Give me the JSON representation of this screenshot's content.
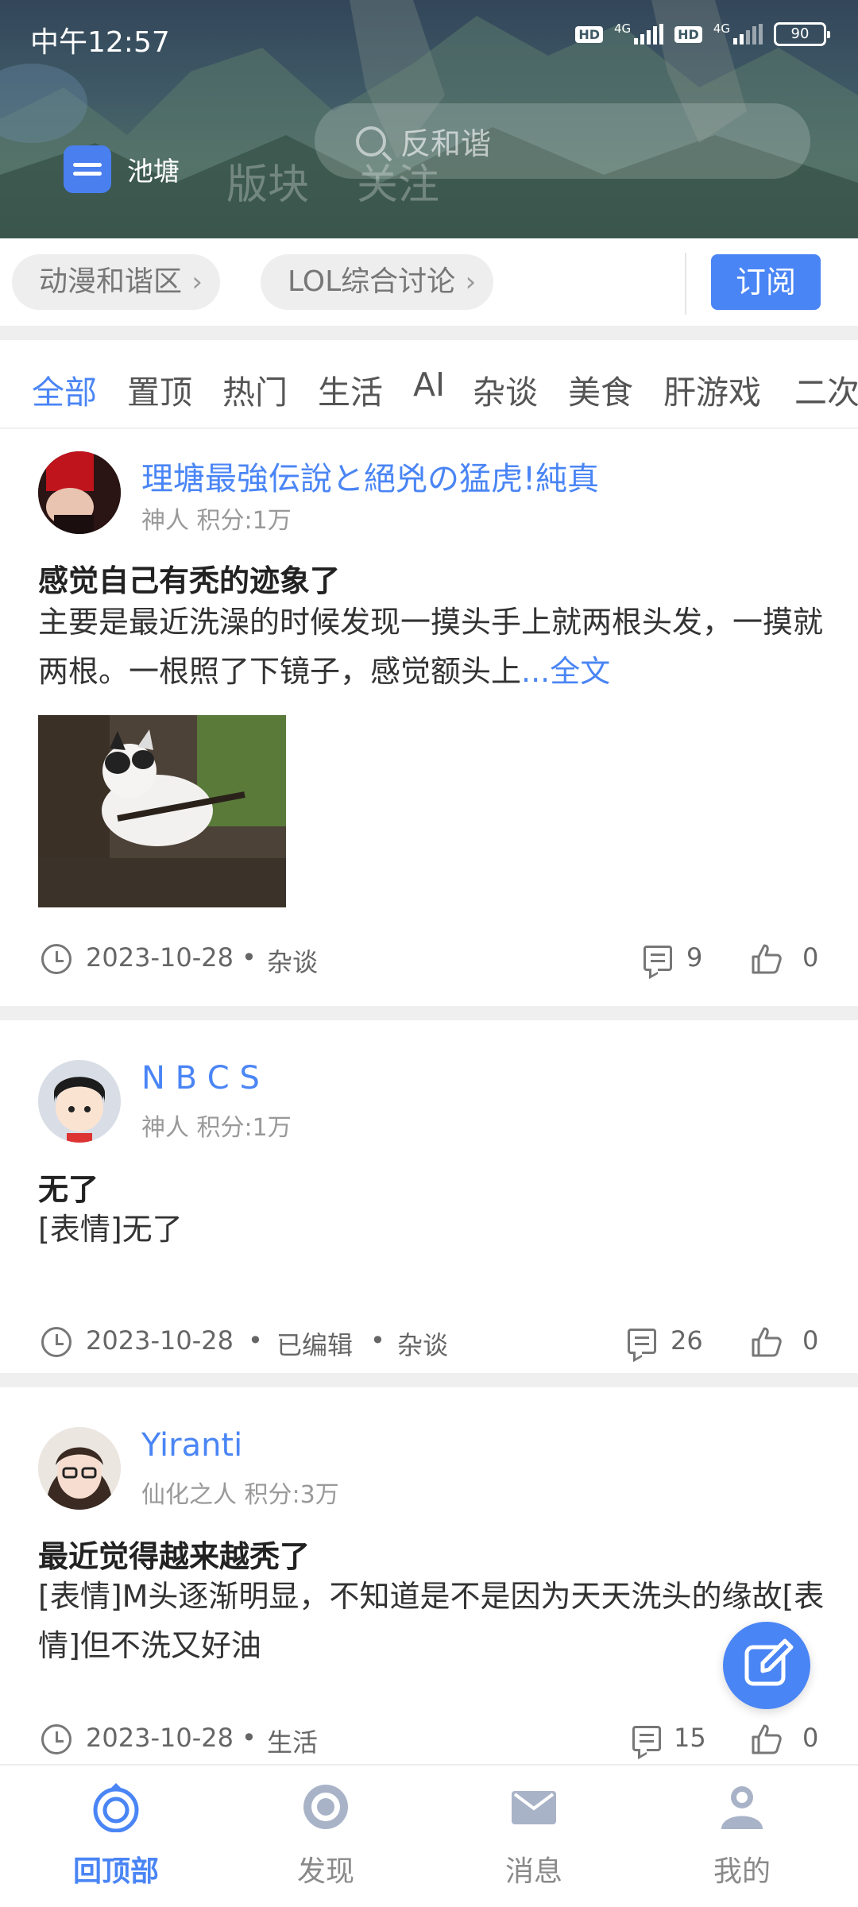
{
  "status_bar": {
    "time": "中午12:57",
    "hd1": "HD",
    "net1": "4G",
    "hd2": "HD",
    "net2": "4G",
    "battery": "90"
  },
  "header": {
    "pool_label": "池塘",
    "ghost_tabs": [
      "版块",
      "关注"
    ],
    "search_placeholder": "反和谐"
  },
  "chips": [
    {
      "label": "动漫和谐区"
    },
    {
      "label": "LOL综合讨论"
    }
  ],
  "subscribe_label": "订阅",
  "categories": [
    "全部",
    "置顶",
    "热门",
    "生活",
    "AI",
    "杂谈",
    "美食",
    "肝游戏",
    "二次"
  ],
  "active_category": "全部",
  "posts": [
    {
      "username": "理塘最強伝說と絕兇の猛虎!純真",
      "rank": "神人",
      "score": "积分:1万",
      "title": "感觉自己有秃的迹象了",
      "body": "主要是最近洗澡的时候发现一摸头手上就两根头发，一摸就两根。一根照了下镜子，感觉额头上",
      "more": "...全文",
      "date": "2023-10-28",
      "edited": "",
      "tag": "杂谈",
      "comments": "9",
      "likes": "0"
    },
    {
      "username": "N B C S",
      "rank": "神人",
      "score": "积分:1万",
      "title": "无了",
      "body": "[表情]无了",
      "date": "2023-10-28",
      "edited": "已编辑",
      "tag": "杂谈",
      "comments": "26",
      "likes": "0"
    },
    {
      "username": "Yiranti",
      "rank": "仙化之人",
      "score": "积分:3万",
      "title": "最近觉得越来越秃了",
      "body": "[表情]M头逐渐明显，不知道是不是因为天天洗头的缘故[表情]但不洗又好油",
      "date": "2023-10-28",
      "edited": "",
      "tag": "生活",
      "comments": "15",
      "likes": "0"
    }
  ],
  "bottom_nav": [
    {
      "label": "回顶部",
      "icon": "top-target-icon"
    },
    {
      "label": "发现",
      "icon": "discover-icon"
    },
    {
      "label": "消息",
      "icon": "mail-icon"
    },
    {
      "label": "我的",
      "icon": "profile-icon"
    }
  ],
  "colors": {
    "accent": "#4a85f5",
    "text": "#222222",
    "muted": "#999999"
  }
}
